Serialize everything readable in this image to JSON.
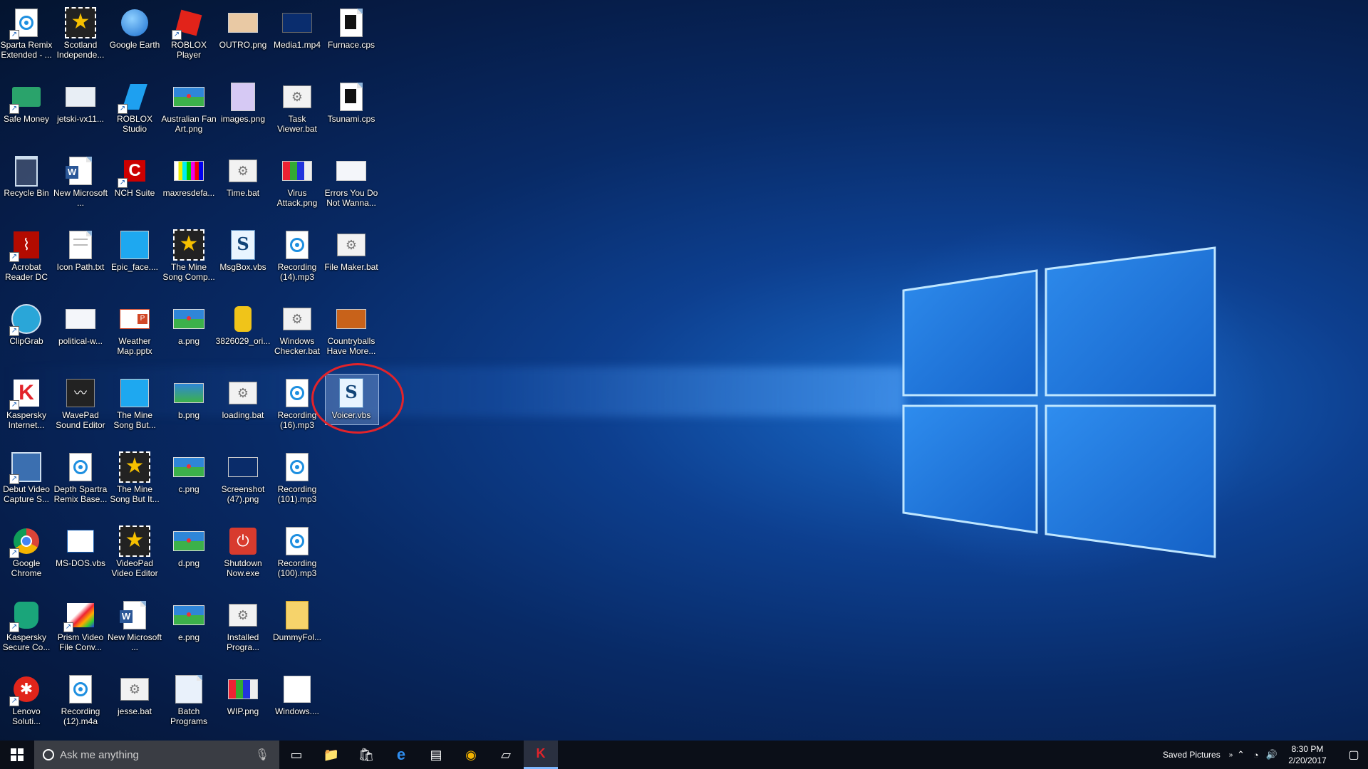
{
  "desktop": {
    "icons": [
      {
        "label": "Sparta Remix Extended - ...",
        "kind": "mp3",
        "col": 0,
        "row": 0,
        "shortcut": true
      },
      {
        "label": "Scotland Independe...",
        "kind": "star",
        "col": 1,
        "row": 0
      },
      {
        "label": "Google Earth",
        "kind": "earth",
        "col": 2,
        "row": 0
      },
      {
        "label": "ROBLOX Player",
        "kind": "roblox",
        "col": 3,
        "row": 0,
        "shortcut": true
      },
      {
        "label": "OUTRO.png",
        "kind": "pic-beige",
        "col": 4,
        "row": 0
      },
      {
        "label": "Media1.mp4",
        "kind": "video",
        "col": 5,
        "row": 0
      },
      {
        "label": "Furnace.cps",
        "kind": "cps",
        "col": 6,
        "row": 0
      },
      {
        "label": "Safe Money",
        "kind": "money",
        "col": 0,
        "row": 1,
        "shortcut": true
      },
      {
        "label": "jetski-vx11...",
        "kind": "pic-gray",
        "col": 1,
        "row": 1
      },
      {
        "label": "ROBLOX Studio",
        "kind": "roblox-studio",
        "col": 2,
        "row": 1,
        "shortcut": true
      },
      {
        "label": "Australian Fan Art.png",
        "kind": "flag",
        "col": 3,
        "row": 1
      },
      {
        "label": "images.png",
        "kind": "pic-purple",
        "col": 4,
        "row": 1
      },
      {
        "label": "Task Viewer.bat",
        "kind": "bat",
        "col": 5,
        "row": 1
      },
      {
        "label": "Tsunami.cps",
        "kind": "cps",
        "col": 6,
        "row": 1
      },
      {
        "label": "Recycle Bin",
        "kind": "recycle",
        "col": 0,
        "row": 2
      },
      {
        "label": "New Microsoft ...",
        "kind": "word",
        "col": 1,
        "row": 2
      },
      {
        "label": "NCH Suite",
        "kind": "nch",
        "col": 2,
        "row": 2,
        "shortcut": true
      },
      {
        "label": "maxresdefa...",
        "kind": "bars",
        "col": 3,
        "row": 2
      },
      {
        "label": "Time.bat",
        "kind": "bat",
        "col": 4,
        "row": 2
      },
      {
        "label": "Virus Attack.png",
        "kind": "pic-multi",
        "col": 5,
        "row": 2
      },
      {
        "label": "Errors You Do Not Wanna...",
        "kind": "pic-white",
        "col": 6,
        "row": 2
      },
      {
        "label": "Acrobat Reader DC",
        "kind": "acrobat",
        "col": 0,
        "row": 3,
        "shortcut": true
      },
      {
        "label": "Icon Path.txt",
        "kind": "txt",
        "col": 1,
        "row": 3
      },
      {
        "label": "Epic_face....",
        "kind": "pic-blue",
        "col": 2,
        "row": 3
      },
      {
        "label": "The Mine Song Comp...",
        "kind": "star",
        "col": 3,
        "row": 3
      },
      {
        "label": "MsgBox.vbs",
        "kind": "vbs",
        "col": 4,
        "row": 3
      },
      {
        "label": "Recording (14).mp3",
        "kind": "mp3",
        "col": 5,
        "row": 3
      },
      {
        "label": "File Maker.bat",
        "kind": "bat",
        "col": 6,
        "row": 3
      },
      {
        "label": "ClipGrab",
        "kind": "clipgrab",
        "col": 0,
        "row": 4,
        "shortcut": true
      },
      {
        "label": "political-w...",
        "kind": "pic-white",
        "col": 1,
        "row": 4
      },
      {
        "label": "Weather Map.pptx",
        "kind": "pptx",
        "col": 2,
        "row": 4
      },
      {
        "label": "a.png",
        "kind": "flag",
        "col": 3,
        "row": 4
      },
      {
        "label": "3826029_ori...",
        "kind": "pic-yellow",
        "col": 4,
        "row": 4
      },
      {
        "label": "Windows Checker.bat",
        "kind": "bat",
        "col": 5,
        "row": 4
      },
      {
        "label": "Countryballs Have More...",
        "kind": "pic-orange",
        "col": 6,
        "row": 4
      },
      {
        "label": "Kaspersky Internet...",
        "kind": "kaspersky",
        "col": 0,
        "row": 5,
        "shortcut": true
      },
      {
        "label": "WavePad Sound Editor",
        "kind": "wavepad",
        "col": 1,
        "row": 5
      },
      {
        "label": "The Mine Song But...",
        "kind": "pic-blue",
        "col": 2,
        "row": 5
      },
      {
        "label": "b.png",
        "kind": "pic-green",
        "col": 3,
        "row": 5
      },
      {
        "label": "loading.bat",
        "kind": "bat",
        "col": 4,
        "row": 5
      },
      {
        "label": "Recording (16).mp3",
        "kind": "mp3",
        "col": 5,
        "row": 5
      },
      {
        "label": "Voicer.vbs",
        "kind": "vbs",
        "col": 6,
        "row": 5,
        "selected": true
      },
      {
        "label": "Debut Video Capture S...",
        "kind": "debut",
        "col": 0,
        "row": 6,
        "shortcut": true
      },
      {
        "label": "Depth Spartra Remix Base...",
        "kind": "mp3",
        "col": 1,
        "row": 6
      },
      {
        "label": "The Mine Song But It...",
        "kind": "star",
        "col": 2,
        "row": 6
      },
      {
        "label": "c.png",
        "kind": "flag",
        "col": 3,
        "row": 6
      },
      {
        "label": "Screenshot (47).png",
        "kind": "pic-dark",
        "col": 4,
        "row": 6
      },
      {
        "label": "Recording (101).mp3",
        "kind": "mp3",
        "col": 5,
        "row": 6
      },
      {
        "label": "Google Chrome",
        "kind": "chrome",
        "col": 0,
        "row": 7,
        "shortcut": true
      },
      {
        "label": "MS-DOS.vbs",
        "kind": "msdos",
        "col": 1,
        "row": 7
      },
      {
        "label": "VideoPad Video Editor",
        "kind": "star",
        "col": 2,
        "row": 7
      },
      {
        "label": "d.png",
        "kind": "flag",
        "col": 3,
        "row": 7
      },
      {
        "label": "Shutdown Now.exe",
        "kind": "shutdown",
        "col": 4,
        "row": 7
      },
      {
        "label": "Recording (100).mp3",
        "kind": "mp3",
        "col": 5,
        "row": 7
      },
      {
        "label": "Kaspersky Secure Co...",
        "kind": "kaspersky-secure",
        "col": 0,
        "row": 8,
        "shortcut": true
      },
      {
        "label": "Prism Video File Conv...",
        "kind": "prism",
        "col": 1,
        "row": 8,
        "shortcut": true
      },
      {
        "label": "New Microsoft ...",
        "kind": "word",
        "col": 2,
        "row": 8
      },
      {
        "label": "e.png",
        "kind": "flag",
        "col": 3,
        "row": 8
      },
      {
        "label": "Installed Progra...",
        "kind": "bat",
        "col": 4,
        "row": 8
      },
      {
        "label": "DummyFol...",
        "kind": "folder",
        "col": 5,
        "row": 8
      },
      {
        "label": "Lenovo Soluti...",
        "kind": "lenovo",
        "col": 0,
        "row": 9,
        "shortcut": true
      },
      {
        "label": "Recording (12).m4a",
        "kind": "mp3",
        "col": 1,
        "row": 9
      },
      {
        "label": "jesse.bat",
        "kind": "bat",
        "col": 2,
        "row": 9
      },
      {
        "label": "Batch Programs",
        "kind": "batch",
        "col": 3,
        "row": 9
      },
      {
        "label": "WIP.png",
        "kind": "pic-multi",
        "col": 4,
        "row": 9
      },
      {
        "label": "Windows....",
        "kind": "pic-win",
        "col": 5,
        "row": 9
      }
    ]
  },
  "taskbar": {
    "search_placeholder": "Ask me anything",
    "apps": [
      {
        "name": "task-view",
        "glyph": "▭"
      },
      {
        "name": "file-explorer",
        "glyph": "📁"
      },
      {
        "name": "store",
        "glyph": "🛍"
      },
      {
        "name": "edge",
        "glyph": "e"
      },
      {
        "name": "cmd",
        "glyph": "▤"
      },
      {
        "name": "chrome",
        "glyph": "◉"
      },
      {
        "name": "notes",
        "glyph": "▱"
      },
      {
        "name": "kaspersky",
        "glyph": "K"
      }
    ],
    "tray_label": "Saved Pictures",
    "time": "8:30 PM",
    "date": "2/20/2017"
  },
  "colors": {
    "accent": "#1e8fe0",
    "highlight_ring": "#e2232a",
    "taskbar_bg": "#0b0f18"
  }
}
